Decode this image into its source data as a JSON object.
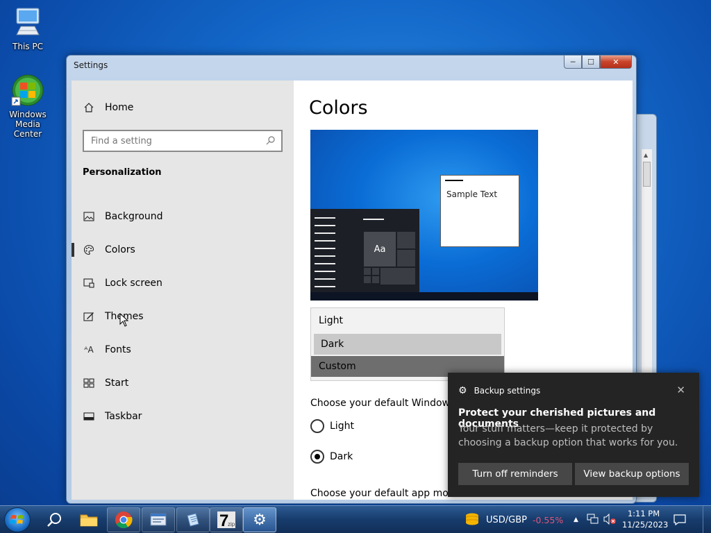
{
  "desktop": {
    "icons": [
      {
        "label": "This PC"
      },
      {
        "label": "Windows Media Center"
      }
    ]
  },
  "window": {
    "title": "Settings",
    "controls": {
      "minimize": "─",
      "maximize": "☐",
      "close": "✕"
    }
  },
  "nav": {
    "home_label": "Home",
    "search": {
      "placeholder": "Find a setting"
    },
    "section_title": "Personalization",
    "items": [
      {
        "label": "Background",
        "icon": "picture-icon"
      },
      {
        "label": "Colors",
        "icon": "palette-icon",
        "active": true
      },
      {
        "label": "Lock screen",
        "icon": "lock-screen-icon"
      },
      {
        "label": "Themes",
        "icon": "themes-icon"
      },
      {
        "label": "Fonts",
        "icon": "fonts-icon"
      },
      {
        "label": "Start",
        "icon": "start-icon"
      },
      {
        "label": "Taskbar",
        "icon": "taskbar-icon"
      }
    ]
  },
  "main": {
    "title": "Colors",
    "preview": {
      "sample_text": "Sample Text",
      "tile_text": "Aa"
    },
    "mode_options": [
      {
        "label": "Light"
      },
      {
        "label": "Dark",
        "selected": true
      },
      {
        "label": "Custom"
      }
    ],
    "windows_mode_label": "Choose your default Windows m",
    "windows_mode_radios": [
      {
        "label": "Light",
        "checked": false
      },
      {
        "label": "Dark",
        "checked": true
      }
    ],
    "app_mode_label": "Choose your default app mode"
  },
  "toast": {
    "app_name": "Backup settings",
    "title": "Protect your cherished pictures and documents",
    "body": "Your stuff matters—keep it protected by choosing a backup option that works for you.",
    "buttons": {
      "turn_off": "Turn off reminders",
      "view": "View backup options"
    }
  },
  "taskbar": {
    "currency": {
      "pair": "USD/GBP",
      "change": "-0.55%",
      "change_color": "#e0567a"
    },
    "clock": {
      "time": "1:11 PM",
      "date": "11/25/2023"
    }
  },
  "colors": {
    "accent": "#0a6dd6",
    "toast_bg": "#242424",
    "nav_bg": "#e6e6e6"
  }
}
